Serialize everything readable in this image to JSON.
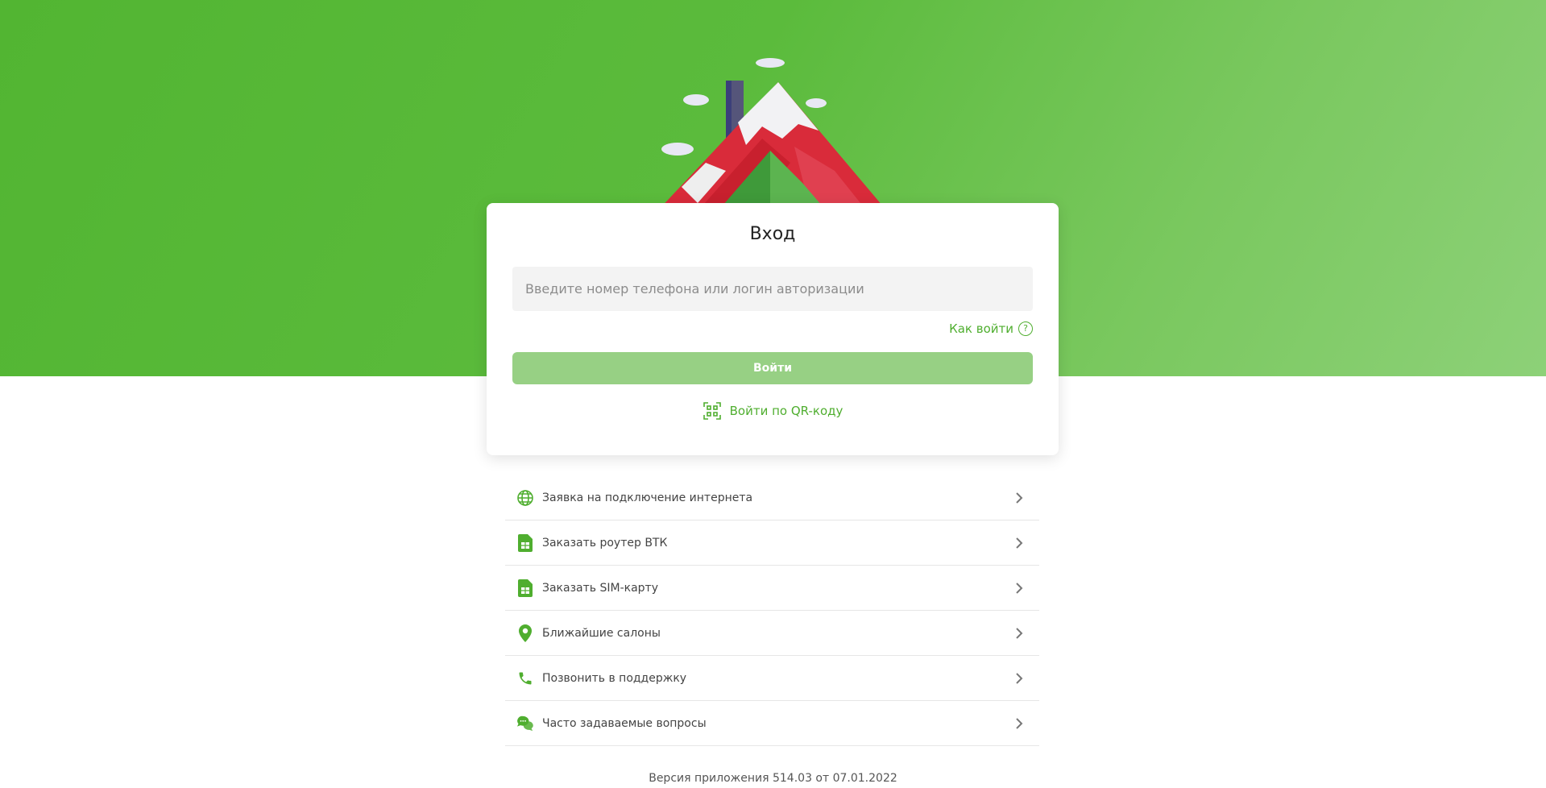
{
  "colors": {
    "brand_green": "#4fae2f",
    "hero_gradient_start": "#52b532",
    "hero_gradient_end": "#8dd178",
    "button_disabled": "#97d084"
  },
  "login_card": {
    "title": "Вход",
    "input": {
      "placeholder": "Введите номер телефона или логин авторизации",
      "value": ""
    },
    "help_link": "Как войти",
    "help_icon": "?",
    "submit_label": "Войти",
    "qr_link": "Войти по QR-коду"
  },
  "menu": {
    "items": [
      {
        "label": "Заявка на подключение интернета",
        "icon": "globe-icon"
      },
      {
        "label": "Заказать роутер ВТК",
        "icon": "sim-card-icon"
      },
      {
        "label": "Заказать SIM-карту",
        "icon": "sim-card-icon"
      },
      {
        "label": "Ближайшие салоны",
        "icon": "map-pin-icon"
      },
      {
        "label": "Позвонить в поддержку",
        "icon": "phone-icon"
      },
      {
        "label": "Часто задаваемые вопросы",
        "icon": "chat-bubbles-icon"
      }
    ]
  },
  "footer": {
    "version": "Версия приложения 514.03 от 07.01.2022"
  }
}
